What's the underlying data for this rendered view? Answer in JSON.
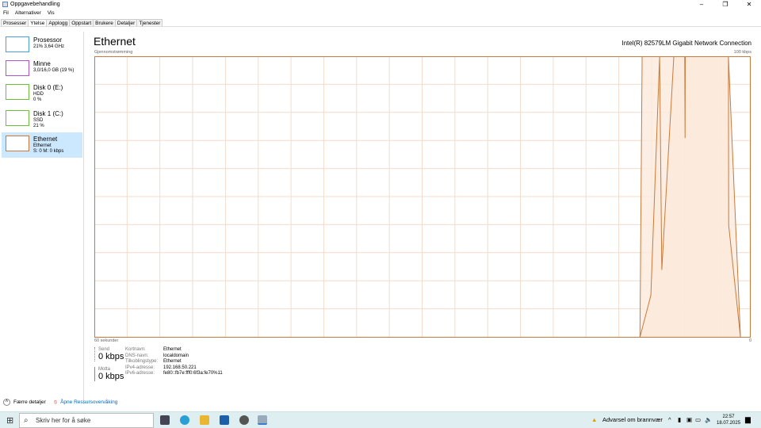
{
  "window": {
    "title": "Oppgavebehandling",
    "controls": [
      "–",
      "❐",
      "✕"
    ]
  },
  "menu": [
    "Fil",
    "Alternativer",
    "Vis"
  ],
  "tabs": [
    {
      "label": "Prosesser"
    },
    {
      "label": "Ytelse",
      "active": true
    },
    {
      "label": "Applogg"
    },
    {
      "label": "Oppstart"
    },
    {
      "label": "Brukere"
    },
    {
      "label": "Detaljer"
    },
    {
      "label": "Tjenester"
    }
  ],
  "sidebar": {
    "items": [
      {
        "name": "Prosessor",
        "line1": "21%  3,64 GHz",
        "line2": "",
        "color": "#4a9ee0"
      },
      {
        "name": "Minne",
        "line1": "3,0/16,0 GB (19 %)",
        "line2": "",
        "color": "#b054d0"
      },
      {
        "name": "Disk 0 (E:)",
        "line1": "HDD",
        "line2": "0 %",
        "color": "#6cbf3c"
      },
      {
        "name": "Disk 1 (C:)",
        "line1": "SSD",
        "line2": "21 %",
        "color": "#6cbf3c"
      },
      {
        "name": "Ethernet",
        "line1": "Ethernet",
        "line2": "S: 0  M: 0 kbps",
        "color": "#c87a3c",
        "active": true
      }
    ]
  },
  "main": {
    "title": "Ethernet",
    "adapter": "Intel(R) 82579LM Gigabit Network Connection"
  },
  "chart_data": {
    "type": "area",
    "title": "Gjennomstrømming",
    "xlabel": "60 sekunder",
    "ymax_label": "100 kbps",
    "ymin_label": "0",
    "xlim": [
      60,
      0
    ],
    "ylim": [
      0,
      100
    ],
    "grid": true,
    "color": "#c87a3c",
    "fill": "#fbeadb",
    "series": [
      {
        "name": "Motta",
        "x": [
          60,
          10.1,
          9.9,
          2.0,
          0.9,
          0
        ],
        "y": [
          0,
          0,
          100,
          100,
          0,
          0
        ]
      },
      {
        "name": "Send",
        "x": [
          60,
          10.1,
          9.1,
          8.3,
          8.1,
          7.0,
          6.0,
          5.97,
          5.95,
          2.0,
          1.98,
          0.9,
          0
        ],
        "y": [
          0,
          0,
          15,
          100,
          24,
          100,
          100,
          71,
          100,
          100,
          40,
          0,
          0
        ]
      }
    ]
  },
  "stats": {
    "send_label": "Send",
    "send_value": "0 kbps",
    "recv_label": "Motta",
    "recv_value": "0 kbps"
  },
  "properties": [
    {
      "k": "Kortnavn:",
      "v": "Ethernet"
    },
    {
      "k": "DNS-navn:",
      "v": "localdomain"
    },
    {
      "k": "Tilkoblingstype:",
      "v": "Ethernet"
    },
    {
      "k": "IPv4-adresse:",
      "v": "192.168.50.221"
    },
    {
      "k": "IPv6-adresse:",
      "v": "fe80::fb7e:fff0:6f3a:fe70%11"
    }
  ],
  "footer": {
    "fewer": "Færre detaljer",
    "monitor": "Åpne Ressursovervåking"
  },
  "taskbar": {
    "search_placeholder": "Skriv her for å søke",
    "warning": "Advarsel om brannvær",
    "time": "22:57",
    "date": "18.07.2025"
  }
}
